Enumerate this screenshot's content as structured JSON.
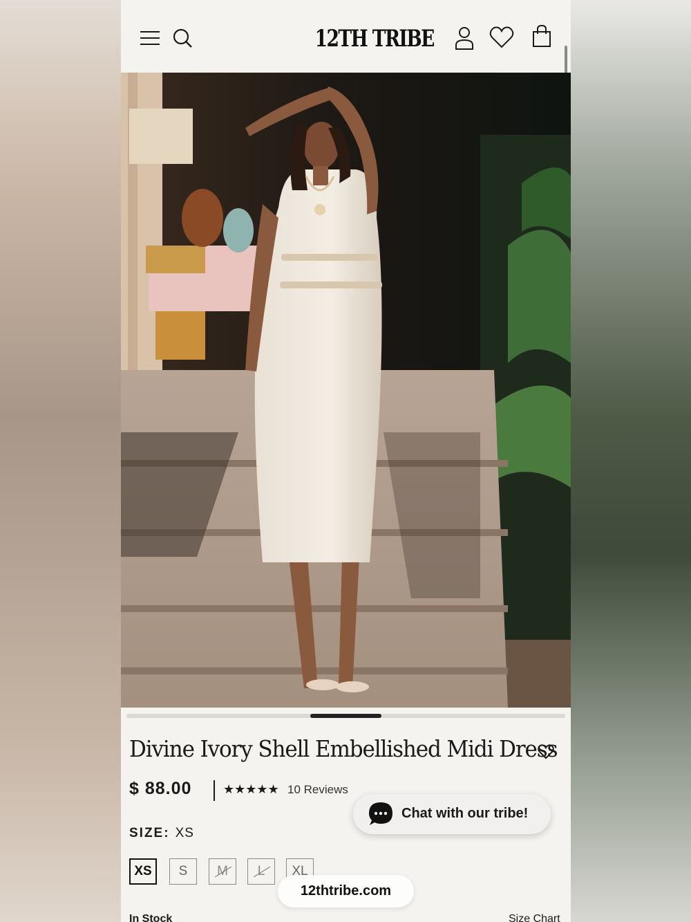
{
  "header": {
    "logo": "12TH TRIBE",
    "menu_icon": "menu-icon",
    "search_icon": "search-icon",
    "account_icon": "account-icon",
    "wishlist_icon": "heart-icon",
    "bag_icon": "shopping-bag-icon"
  },
  "product": {
    "title": "Divine Ivory Shell Embellished Midi Dress",
    "price": "$ 88.00",
    "rating_stars": "★★★★★",
    "rating": 5,
    "reviews": "10 Reviews",
    "size_label": "SIZE:",
    "selected_size": "XS",
    "sizes": [
      "XS",
      "S",
      "M",
      "L",
      "XL"
    ],
    "unavailable_sizes": [
      "M",
      "L"
    ],
    "stock": "In Stock",
    "size_chart": "Size Chart"
  },
  "carousel": {
    "current_slide_fraction": 0.5
  },
  "chat": {
    "label": "Chat with our tribe!"
  },
  "browser": {
    "url": "12thtribe.com"
  },
  "colors": {
    "background": "#f4f3f0",
    "text": "#1a1a1a",
    "accent": "#111111"
  }
}
